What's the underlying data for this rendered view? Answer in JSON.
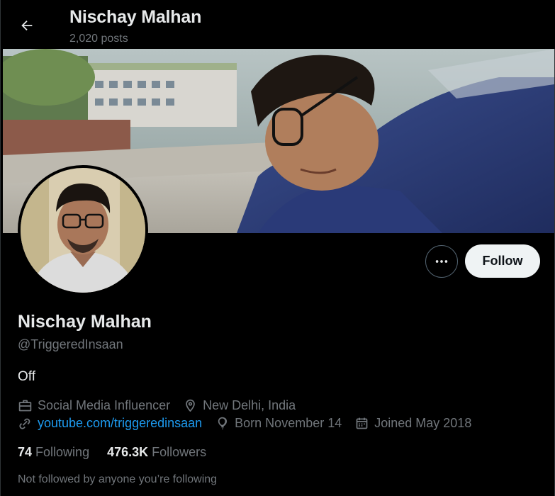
{
  "header": {
    "title": "Nischay Malhan",
    "posts_count": "2,020 posts"
  },
  "profile": {
    "display_name": "Nischay Malhan",
    "handle": "@TriggeredInsaan",
    "bio": "Off",
    "category": "Social Media Influencer",
    "location": "New Delhi, India",
    "website": "youtube.com/triggeredinsaan",
    "birthday": "Born November 14",
    "joined": "Joined May 2018"
  },
  "stats": {
    "following_count": "74",
    "following_label": "Following",
    "followers_count": "476.3K",
    "followers_label": "Followers"
  },
  "social_context": "Not followed by anyone you’re following",
  "actions": {
    "follow_label": "Follow",
    "more_icon": "ellipsis-icon"
  },
  "icons": {
    "back": "arrow-left-icon",
    "category": "briefcase-icon",
    "location": "location-pin-icon",
    "website": "link-icon",
    "birthday": "balloon-icon",
    "joined": "calendar-icon"
  },
  "colors": {
    "background": "#000000",
    "primary_text": "#e7e9ea",
    "secondary_text": "#71767b",
    "link": "#1d9bf0",
    "follow_button_bg": "#eff3f4",
    "follow_button_text": "#0f1419"
  }
}
